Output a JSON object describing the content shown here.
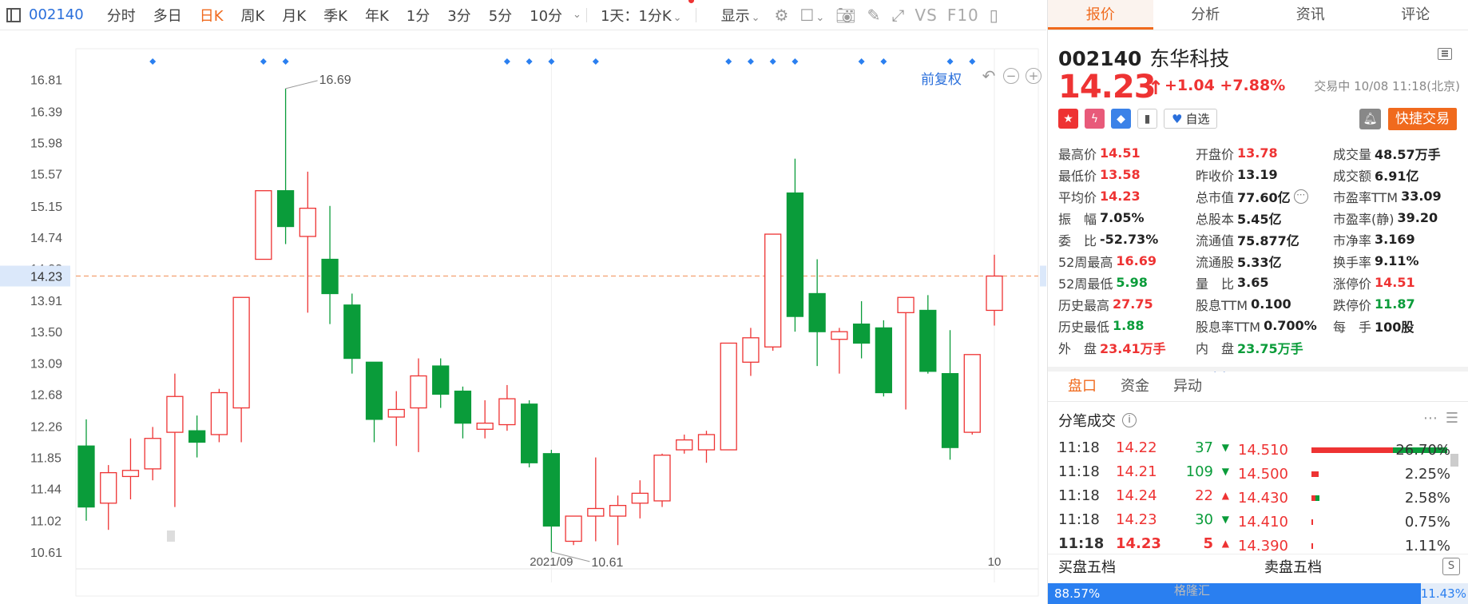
{
  "toolbar": {
    "code": "002140",
    "periods": [
      "分时",
      "多日",
      "日K",
      "周K",
      "月K",
      "季K",
      "年K",
      "1分",
      "3分",
      "5分",
      "10分"
    ],
    "active_period": "日K",
    "range_select": "1天：1分K",
    "display_label": "显示",
    "vs_label": "VS",
    "f10_label": "F10",
    "icons": [
      "layout-icon",
      "gear-icon",
      "square-icon",
      "camera-icon",
      "pencil-icon",
      "fullscreen-icon",
      "sidebar-icon"
    ]
  },
  "chart_toolbar": {
    "adjust_label": "前复权"
  },
  "chart_data": {
    "type": "candlestick",
    "y_ticks": [
      "16.81",
      "16.39",
      "15.98",
      "15.57",
      "15.15",
      "14.74",
      "14.33",
      "13.91",
      "13.50",
      "13.09",
      "12.68",
      "12.26",
      "11.85",
      "11.44",
      "11.02",
      "10.61"
    ],
    "y_tick_values": [
      16.81,
      16.39,
      15.98,
      15.57,
      15.15,
      14.74,
      14.33,
      13.91,
      13.5,
      13.09,
      12.68,
      12.26,
      11.85,
      11.44,
      11.02,
      10.61
    ],
    "ylim": [
      10.21,
      17.15
    ],
    "x_labels": [
      {
        "label": "2021/09",
        "index": 21
      },
      {
        "label": "10",
        "index": 41
      }
    ],
    "current_price": "14.23",
    "current_price_value": 14.23,
    "high_marker": {
      "label": "16.69",
      "index": 9,
      "value": 16.69
    },
    "low_marker": {
      "label": "10.61",
      "index": 21,
      "value": 10.61
    },
    "event_markers": [
      3,
      8,
      9,
      19,
      20,
      21,
      23,
      29,
      30,
      31,
      32,
      35,
      36,
      39,
      40
    ],
    "candles": [
      {
        "o": 12.0,
        "h": 12.35,
        "l": 11.02,
        "c": 11.2
      },
      {
        "o": 11.25,
        "h": 11.75,
        "l": 10.9,
        "c": 11.65
      },
      {
        "o": 11.6,
        "h": 12.1,
        "l": 11.3,
        "c": 11.68
      },
      {
        "o": 11.7,
        "h": 12.25,
        "l": 11.55,
        "c": 12.1
      },
      {
        "o": 12.18,
        "h": 12.95,
        "l": 11.2,
        "c": 12.65
      },
      {
        "o": 12.2,
        "h": 12.4,
        "l": 11.85,
        "c": 12.05
      },
      {
        "o": 12.15,
        "h": 12.75,
        "l": 12.05,
        "c": 12.7
      },
      {
        "o": 12.5,
        "h": 13.95,
        "l": 12.05,
        "c": 13.95
      },
      {
        "o": 14.45,
        "h": 15.35,
        "l": 14.45,
        "c": 15.35
      },
      {
        "o": 15.35,
        "h": 16.69,
        "l": 14.65,
        "c": 14.88
      },
      {
        "o": 14.75,
        "h": 15.6,
        "l": 13.75,
        "c": 15.12
      },
      {
        "o": 14.45,
        "h": 15.15,
        "l": 13.6,
        "c": 14.0
      },
      {
        "o": 13.85,
        "h": 14.0,
        "l": 12.95,
        "c": 13.15
      },
      {
        "o": 13.1,
        "h": 13.1,
        "l": 12.05,
        "c": 12.35
      },
      {
        "o": 12.38,
        "h": 12.72,
        "l": 12.0,
        "c": 12.48
      },
      {
        "o": 12.5,
        "h": 13.15,
        "l": 11.92,
        "c": 12.92
      },
      {
        "o": 13.05,
        "h": 13.15,
        "l": 12.5,
        "c": 12.68
      },
      {
        "o": 12.72,
        "h": 12.78,
        "l": 12.1,
        "c": 12.3
      },
      {
        "o": 12.22,
        "h": 12.6,
        "l": 12.1,
        "c": 12.3
      },
      {
        "o": 12.28,
        "h": 12.8,
        "l": 12.2,
        "c": 12.62
      },
      {
        "o": 12.55,
        "h": 12.6,
        "l": 11.72,
        "c": 11.78
      },
      {
        "o": 11.9,
        "h": 11.95,
        "l": 10.61,
        "c": 10.95
      },
      {
        "o": 10.75,
        "h": 11.05,
        "l": 10.7,
        "c": 11.08
      },
      {
        "o": 11.08,
        "h": 11.85,
        "l": 10.75,
        "c": 11.18
      },
      {
        "o": 11.08,
        "h": 11.35,
        "l": 10.7,
        "c": 11.22
      },
      {
        "o": 11.25,
        "h": 11.55,
        "l": 11.05,
        "c": 11.38
      },
      {
        "o": 11.28,
        "h": 11.9,
        "l": 11.2,
        "c": 11.88
      },
      {
        "o": 11.95,
        "h": 12.15,
        "l": 11.9,
        "c": 12.08
      },
      {
        "o": 11.95,
        "h": 12.2,
        "l": 11.78,
        "c": 12.15
      },
      {
        "o": 11.95,
        "h": 13.35,
        "l": 11.95,
        "c": 13.35
      },
      {
        "o": 13.1,
        "h": 13.55,
        "l": 12.92,
        "c": 13.42
      },
      {
        "o": 13.3,
        "h": 14.48,
        "l": 13.25,
        "c": 14.78
      },
      {
        "o": 15.32,
        "h": 15.77,
        "l": 13.5,
        "c": 13.7
      },
      {
        "o": 14.0,
        "h": 14.45,
        "l": 13.05,
        "c": 13.5
      },
      {
        "o": 13.4,
        "h": 13.55,
        "l": 12.95,
        "c": 13.5
      },
      {
        "o": 13.6,
        "h": 13.9,
        "l": 13.15,
        "c": 13.35
      },
      {
        "o": 13.55,
        "h": 13.65,
        "l": 12.65,
        "c": 12.7
      },
      {
        "o": 13.75,
        "h": 13.95,
        "l": 12.48,
        "c": 13.95
      },
      {
        "o": 13.78,
        "h": 13.98,
        "l": 12.95,
        "c": 12.98
      },
      {
        "o": 12.95,
        "h": 13.52,
        "l": 11.82,
        "c": 11.98
      },
      {
        "o": 12.18,
        "h": 13.2,
        "l": 12.15,
        "c": 13.2
      },
      {
        "o": 13.78,
        "h": 14.51,
        "l": 13.58,
        "c": 14.23
      }
    ]
  },
  "panel": {
    "tabs": [
      "报价",
      "分析",
      "资讯",
      "评论"
    ],
    "active_tab": "报价",
    "code": "002140",
    "name": "东华科技",
    "price": "14.23",
    "change": "+1.04 +7.88%",
    "trade_status": "交易中 10/08 11:18(北京)",
    "zixuan_label": "自选",
    "quick_trade_label": "快捷交易",
    "stats": [
      [
        {
          "l": "最高价",
          "v": "14.51",
          "c": "red"
        },
        {
          "l": "开盘价",
          "v": "13.78",
          "c": "red"
        },
        {
          "l": "成交量",
          "v": "48.57万手",
          "c": ""
        }
      ],
      [
        {
          "l": "最低价",
          "v": "13.58",
          "c": "red"
        },
        {
          "l": "昨收价",
          "v": "13.19",
          "c": ""
        },
        {
          "l": "成交额",
          "v": "6.91亿",
          "c": ""
        }
      ],
      [
        {
          "l": "平均价",
          "v": "14.23",
          "c": "red"
        },
        {
          "l": "总市值",
          "v": "77.60亿",
          "c": ""
        },
        {
          "l": "市盈率TTM",
          "v": "33.09",
          "c": ""
        }
      ],
      [
        {
          "l": "振　幅",
          "v": "7.05%",
          "c": ""
        },
        {
          "l": "总股本",
          "v": "5.45亿",
          "c": ""
        },
        {
          "l": "市盈率(静)",
          "v": "39.20",
          "c": ""
        }
      ],
      [
        {
          "l": "委　比",
          "v": "-52.73%",
          "c": ""
        },
        {
          "l": "流通值",
          "v": "75.877亿",
          "c": ""
        },
        {
          "l": "市净率",
          "v": "3.169",
          "c": ""
        }
      ],
      [
        {
          "l": "52周最高",
          "v": "16.69",
          "c": "red"
        },
        {
          "l": "流通股",
          "v": "5.33亿",
          "c": ""
        },
        {
          "l": "换手率",
          "v": "9.11%",
          "c": ""
        }
      ],
      [
        {
          "l": "52周最低",
          "v": "5.98",
          "c": "green"
        },
        {
          "l": "量　比",
          "v": "3.65",
          "c": ""
        },
        {
          "l": "涨停价",
          "v": "14.51",
          "c": "red"
        }
      ],
      [
        {
          "l": "历史最高",
          "v": "27.75",
          "c": "red"
        },
        {
          "l": "股息TTM",
          "v": "0.100",
          "c": ""
        },
        {
          "l": "跌停价",
          "v": "11.87",
          "c": "green"
        }
      ],
      [
        {
          "l": "历史最低",
          "v": "1.88",
          "c": "green"
        },
        {
          "l": "股息率TTM",
          "v": "0.700%",
          "c": ""
        },
        {
          "l": "每　手",
          "v": "100股",
          "c": ""
        }
      ],
      [
        {
          "l": "外　盘",
          "v": "23.41万手",
          "c": "red"
        },
        {
          "l": "内　盘",
          "v": "23.75万手",
          "c": "green"
        }
      ]
    ],
    "subtabs": [
      "盘口",
      "资金",
      "异动"
    ],
    "active_subtab": "盘口",
    "ticks_title": "分笔成交",
    "ticks": [
      {
        "t": "11:18",
        "p": "14.22",
        "v": "37",
        "dir": "down"
      },
      {
        "t": "11:18",
        "p": "14.21",
        "v": "109",
        "dir": "down"
      },
      {
        "t": "11:18",
        "p": "14.24",
        "v": "22",
        "dir": "up"
      },
      {
        "t": "11:18",
        "p": "14.23",
        "v": "30",
        "dir": "down"
      },
      {
        "t": "11:18",
        "p": "14.23",
        "v": "5",
        "dir": "up"
      }
    ],
    "levels": [
      {
        "p": "14.510",
        "pct": "26.70%",
        "r": 0.6,
        "g": 0.4
      },
      {
        "p": "14.500",
        "pct": "2.25%",
        "r": 0.05,
        "g": 0
      },
      {
        "p": "14.430",
        "pct": "2.58%",
        "r": 0.03,
        "g": 0.03
      },
      {
        "p": "14.410",
        "pct": "0.75%",
        "r": 0.01,
        "g": 0
      },
      {
        "p": "14.390",
        "pct": "1.11%",
        "r": 0.01,
        "g": 0
      }
    ],
    "buy_label": "买盘五档",
    "sell_label": "卖盘五档",
    "buy_ratio": "88.57%",
    "sell_ratio": "11.43%",
    "buy_fraction": 0.8857,
    "watermark": "格隆汇"
  }
}
